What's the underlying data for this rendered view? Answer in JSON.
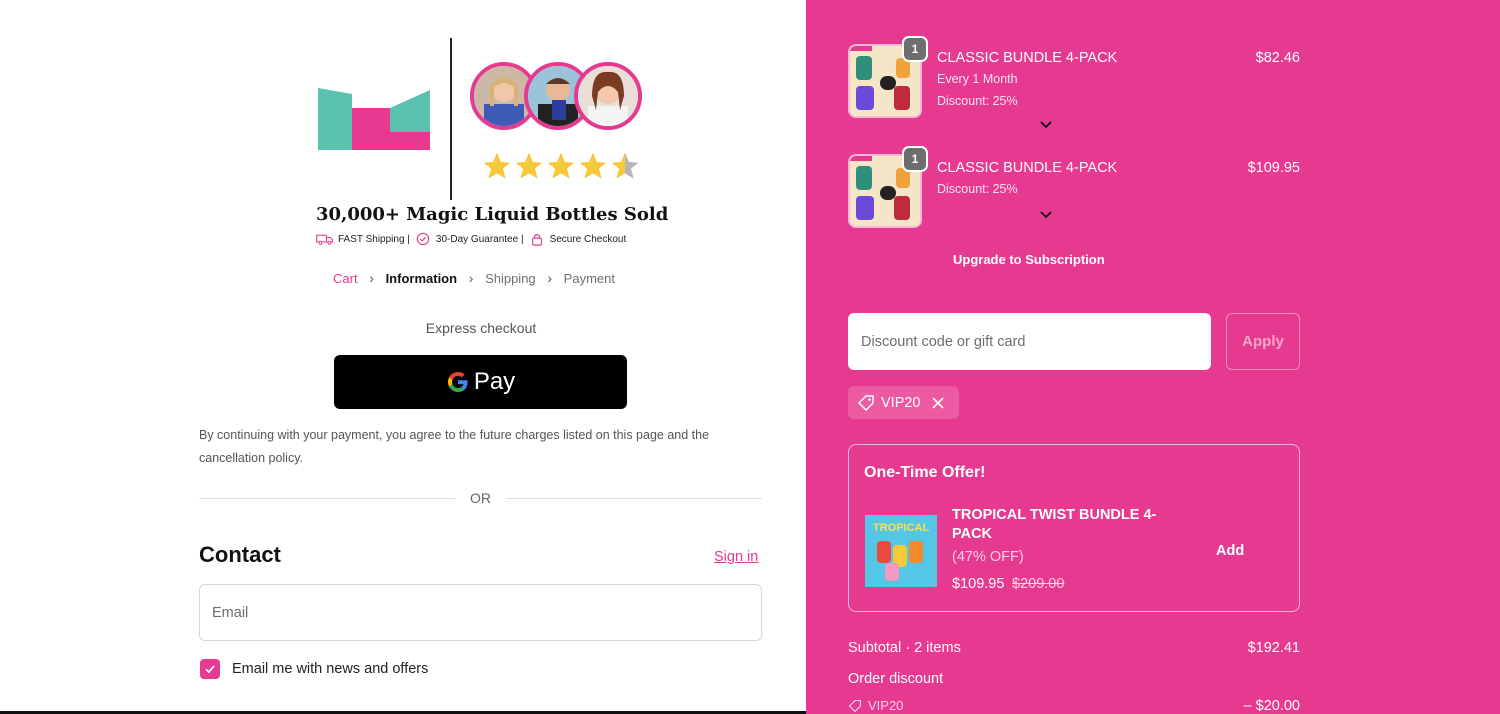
{
  "brand": {
    "headline": "30,000+ Magic Liquid Bottles Sold",
    "trust": [
      "FAST Shipping |",
      "30-Day Guarantee |",
      "Secure Checkout"
    ],
    "rating": 4.5
  },
  "breadcrumb": {
    "items": [
      "Cart",
      "Information",
      "Shipping",
      "Payment"
    ],
    "current": "Information"
  },
  "express": {
    "label": "Express checkout",
    "gpay_label": "Pay",
    "terms": "By continuing with your payment, you agree to the future charges listed on this page and the cancellation policy."
  },
  "or_text": "OR",
  "contact": {
    "title": "Contact",
    "sign_in": "Sign in",
    "email_placeholder": "Email",
    "news_label": "Email me with news and offers",
    "news_checked": true
  },
  "cart": {
    "items": [
      {
        "quantity": "1",
        "title": "CLASSIC BUNDLE 4-PACK",
        "price": "$82.46",
        "subs": [
          "Every 1 Month",
          "Discount: 25%"
        ]
      },
      {
        "quantity": "1",
        "title": "CLASSIC BUNDLE 4-PACK",
        "price": "$109.95",
        "subs": [
          "Discount: 25%"
        ]
      }
    ],
    "upgrade_label": "Upgrade to Subscription"
  },
  "discount": {
    "placeholder": "Discount code or gift card",
    "apply_label": "Apply",
    "applied_code": "VIP20"
  },
  "offer": {
    "title": "One-Time Offer!",
    "product": "TROPICAL TWIST BUNDLE 4-PACK",
    "percent_off": "(47% OFF)",
    "price": "$109.95",
    "compare_price": "$209.00",
    "add_label": "Add"
  },
  "summary": {
    "subtotal_label": "Subtotal · 2 items",
    "subtotal_value": "$192.41",
    "discount_label": "Order discount",
    "discount_code": "VIP20",
    "discount_value": "– $20.00"
  },
  "colors": {
    "accent": "#e63a91",
    "logo_teal": "#5cc2b0",
    "logo_pink": "#e63a91",
    "star": "#f5c93a"
  }
}
